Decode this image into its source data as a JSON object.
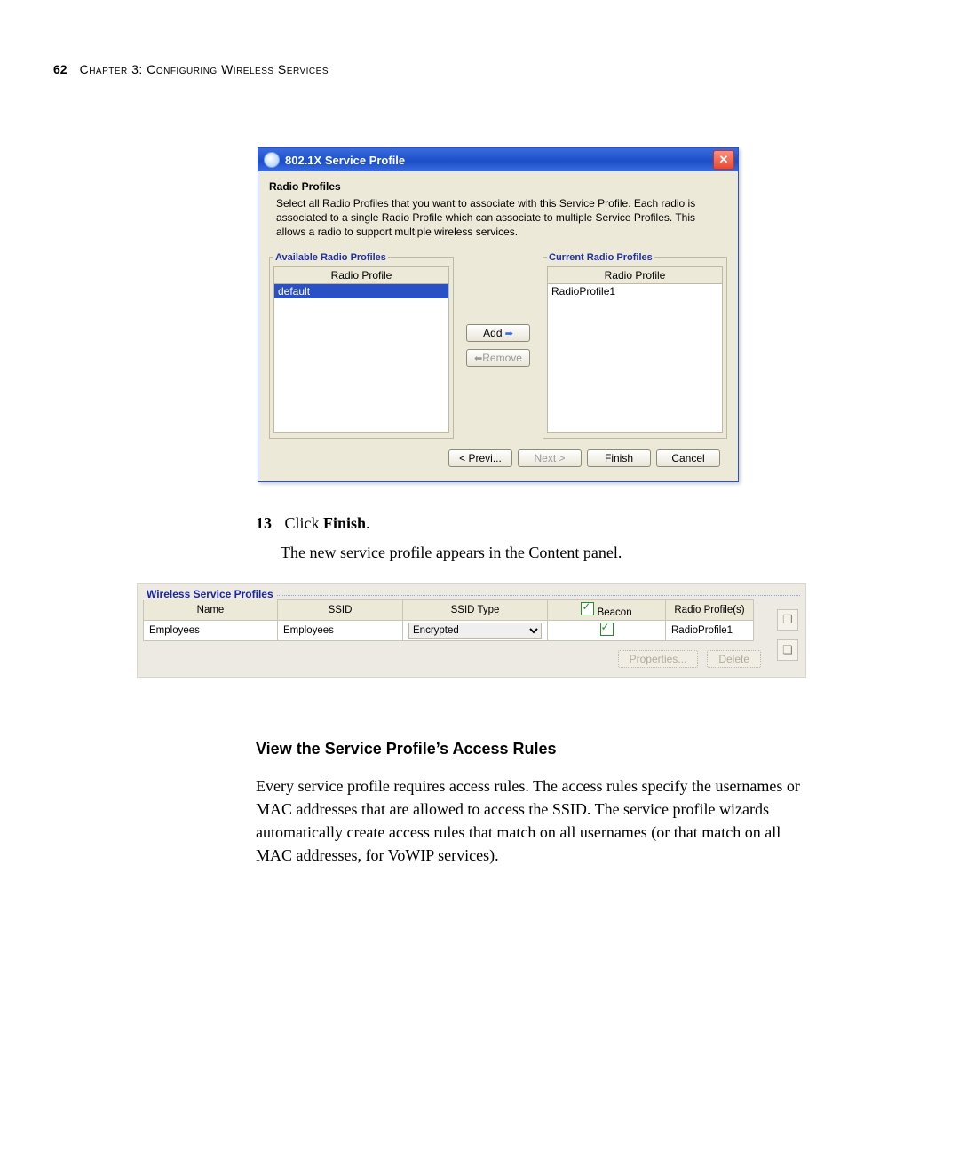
{
  "page": {
    "number": "62",
    "chapter": "Chapter 3: Configuring Wireless Services"
  },
  "dialog": {
    "title": "802.1X Service Profile",
    "section": "Radio Profiles",
    "description": "Select all Radio Profiles that you want to associate with this Service Profile. Each radio is associated to a single Radio Profile which can associate to multiple Service Profiles. This allows a radio to support multiple wireless services.",
    "available": {
      "legend": "Available Radio Profiles",
      "col": "Radio Profile",
      "items": [
        "default"
      ]
    },
    "current": {
      "legend": "Current Radio Profiles",
      "col": "Radio Profile",
      "items": [
        "RadioProfile1"
      ]
    },
    "buttons": {
      "add": "Add",
      "remove": "Remove",
      "prev": "< Previ...",
      "next": "Next >",
      "finish": "Finish",
      "cancel": "Cancel"
    }
  },
  "step": {
    "num": "13",
    "text_prefix": "Click ",
    "text_bold": "Finish",
    "text_suffix": ".",
    "desc": "The new service profile appears in the Content panel."
  },
  "wsp": {
    "legend": "Wireless Service Profiles",
    "cols": {
      "name": "Name",
      "ssid": "SSID",
      "ssid_type": "SSID Type",
      "beacon": "Beacon",
      "radio": "Radio Profile(s)"
    },
    "row": {
      "name": "Employees",
      "ssid": "Employees",
      "ssid_type": "Encrypted",
      "radio": "RadioProfile1"
    },
    "buttons": {
      "properties": "Properties...",
      "delete": "Delete"
    }
  },
  "section": {
    "heading": "View the Service Profile’s Access Rules",
    "body": "Every service profile requires access rules. The access rules specify the usernames or MAC addresses that are allowed to access the SSID. The service profile wizards automatically create access rules that match on all usernames (or that match on all MAC addresses, for VoWIP services)."
  }
}
